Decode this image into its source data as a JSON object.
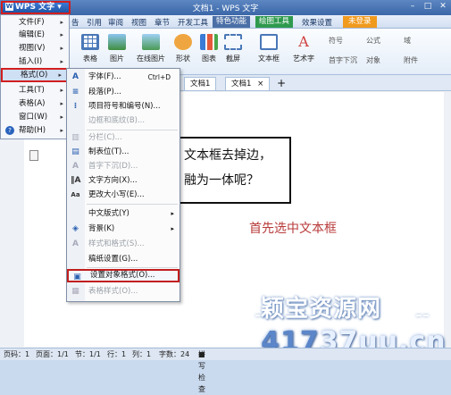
{
  "app": {
    "logo_label": "WPS 文字",
    "window_title": "文档1 - WPS 文字"
  },
  "menubar": {
    "tabs": [
      "视图",
      "章节",
      "开发工具",
      "特色功能",
      "绘图工具",
      "效果设置"
    ],
    "left_tabs": [
      "插入",
      "页面布局",
      "引用",
      "审阅"
    ],
    "left_tabs_visible": [
      "告",
      "引用",
      "审阅"
    ],
    "login": "未登录"
  },
  "ribbon": {
    "items": [
      "表格",
      "图片",
      "在线图片",
      "形状",
      "图表",
      "截屏",
      "文本框",
      "艺术字",
      "对象",
      "附件"
    ],
    "small": [
      "符号",
      "公式",
      "首字下沉",
      "域"
    ]
  },
  "doctabs": [
    "文档1",
    "文档1"
  ],
  "main_menu": {
    "items": [
      {
        "label": "文件(F)"
      },
      {
        "label": "编辑(E)"
      },
      {
        "label": "视图(V)"
      },
      {
        "label": "插入(I)"
      },
      {
        "label": "格式(O)"
      },
      {
        "label": "工具(T)"
      },
      {
        "label": "表格(A)"
      },
      {
        "label": "窗口(W)"
      },
      {
        "label": "帮助(H)"
      }
    ]
  },
  "format_menu": {
    "items": [
      {
        "label": "字体(F)...",
        "shortcut": "Ctrl+D"
      },
      {
        "label": "段落(P)..."
      },
      {
        "label": "项目符号和编号(N)..."
      },
      {
        "label": "边框和底纹(B)..."
      },
      {
        "label": "分栏(C)..."
      },
      {
        "label": "制表位(T)..."
      },
      {
        "label": "首字下沉(D)..."
      },
      {
        "label": "文字方向(X)..."
      },
      {
        "label": "更改大小写(E)..."
      },
      {
        "label": "中文版式(Y)"
      },
      {
        "label": "背景(K)"
      },
      {
        "label": "样式和格式(S)..."
      },
      {
        "label": "稿纸设置(G)..."
      },
      {
        "label": "设置对象格式(O)..."
      },
      {
        "label": "表格样式(O)..."
      }
    ]
  },
  "document": {
    "frame_line1": "文本框去掉边，",
    "frame_line2": "融为一体呢？",
    "caption": "首先选中文本框"
  },
  "statusbar": {
    "page": "页码：1",
    "pages": "页面：1/1",
    "section": "节：1/1",
    "row": "行：1",
    "col": "列：1",
    "chars": "字数：24",
    "spell": "拼写检查"
  },
  "watermark": {
    "site": "颖宝资源网",
    "url": "417",
    "url2": "37uu.cn"
  },
  "colors": {
    "highlight_border": "#d21f1f",
    "caption": "#b83a3a"
  }
}
